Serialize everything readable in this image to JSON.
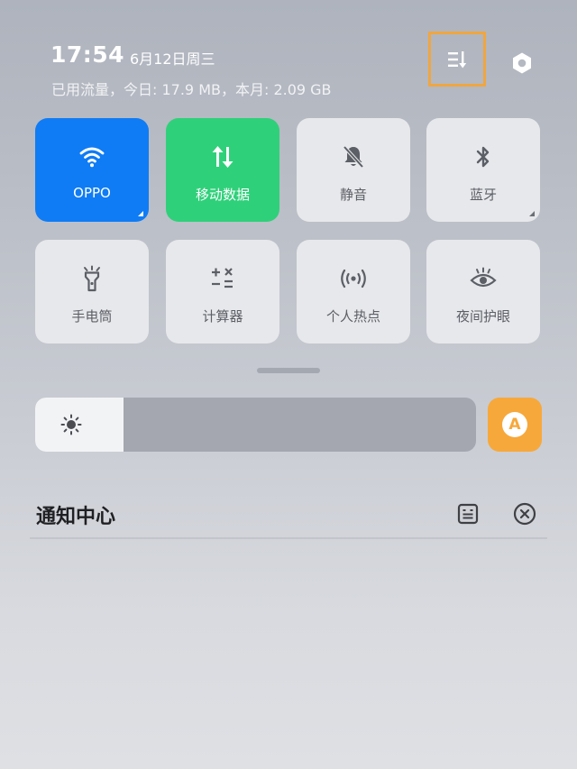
{
  "status": {
    "time": "17:54",
    "date": "6月12日周三",
    "traffic": "已用流量，今日: 17.9 MB，本月: 2.09 GB"
  },
  "header_icons": {
    "sort": "sort-icon",
    "settings": "settings-icon"
  },
  "tiles": [
    {
      "label": "OPPO",
      "icon": "wifi-icon",
      "state": "on",
      "color": "#0f7cf5"
    },
    {
      "label": "移动数据",
      "icon": "mobile-data-icon",
      "state": "on",
      "color": "#2fd07a"
    },
    {
      "label": "静音",
      "icon": "mute-bell-icon",
      "state": "off"
    },
    {
      "label": "蓝牙",
      "icon": "bluetooth-icon",
      "state": "off"
    },
    {
      "label": "手电筒",
      "icon": "flashlight-icon",
      "state": "off"
    },
    {
      "label": "计算器",
      "icon": "calculator-icon",
      "state": "off"
    },
    {
      "label": "个人热点",
      "icon": "hotspot-icon",
      "state": "off"
    },
    {
      "label": "夜间护眼",
      "icon": "eye-icon",
      "state": "off"
    }
  ],
  "brightness": {
    "level": 0.2,
    "auto_label": "A"
  },
  "notifications": {
    "title": "通知中心"
  }
}
